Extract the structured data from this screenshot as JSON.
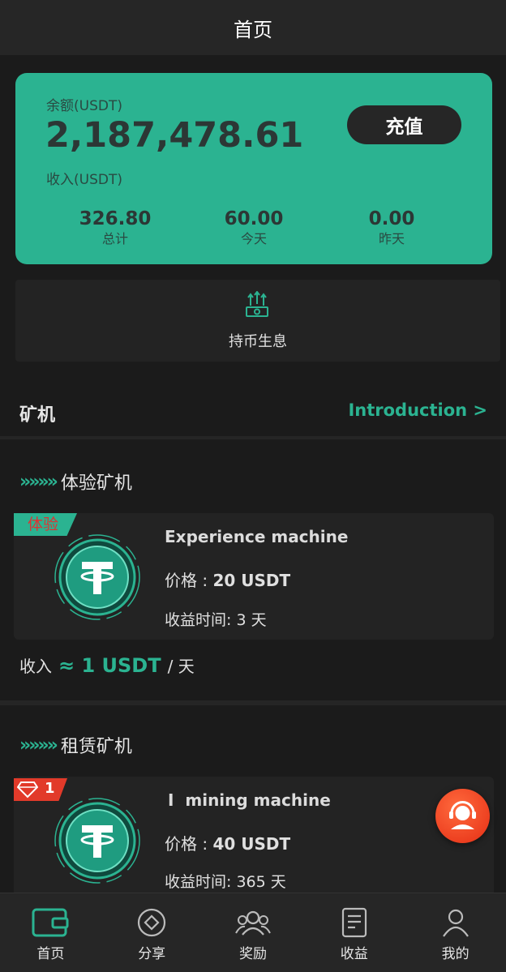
{
  "header": {
    "title": "首页"
  },
  "balance": {
    "label": "余额(USDT)",
    "value": "2,187,478.61",
    "income_label": "收入(USDT)",
    "recharge_label": "充值",
    "stats": [
      {
        "value": "326.80",
        "label": "总计"
      },
      {
        "value": "60.00",
        "label": "今天"
      },
      {
        "value": "0.00",
        "label": "昨天"
      }
    ]
  },
  "holding": {
    "label": "持币生息",
    "icon": "money-stack-icon"
  },
  "miners": {
    "title": "矿机",
    "intro_link": "Introduction >"
  },
  "experience": {
    "category": "体验矿机",
    "badge": "体验",
    "name": "Experience machine",
    "price_label": "价格 : ",
    "price": "20 USDT",
    "time_label": "收益时间: ",
    "time_value": "3",
    "time_unit": "天",
    "income_label": "收入",
    "income_approx": "≈ 1 USDT",
    "income_unit": "/ 天"
  },
  "rental": {
    "category": "租赁矿机",
    "badge_num": "1",
    "name": "I  mining machine",
    "price_label": "价格 : ",
    "price": "40 USDT",
    "time_label": "收益时间: ",
    "time_value": "365",
    "time_unit": "天"
  },
  "tabs": [
    {
      "label": "首页",
      "icon": "wallet-icon"
    },
    {
      "label": "分享",
      "icon": "share-diamond-icon"
    },
    {
      "label": "奖励",
      "icon": "group-icon"
    },
    {
      "label": "收益",
      "icon": "document-icon"
    },
    {
      "label": "我的",
      "icon": "user-icon"
    }
  ],
  "colors": {
    "accent": "#2bb391",
    "background": "#1b1b1b",
    "card": "#232323",
    "support": "#e52e14"
  }
}
